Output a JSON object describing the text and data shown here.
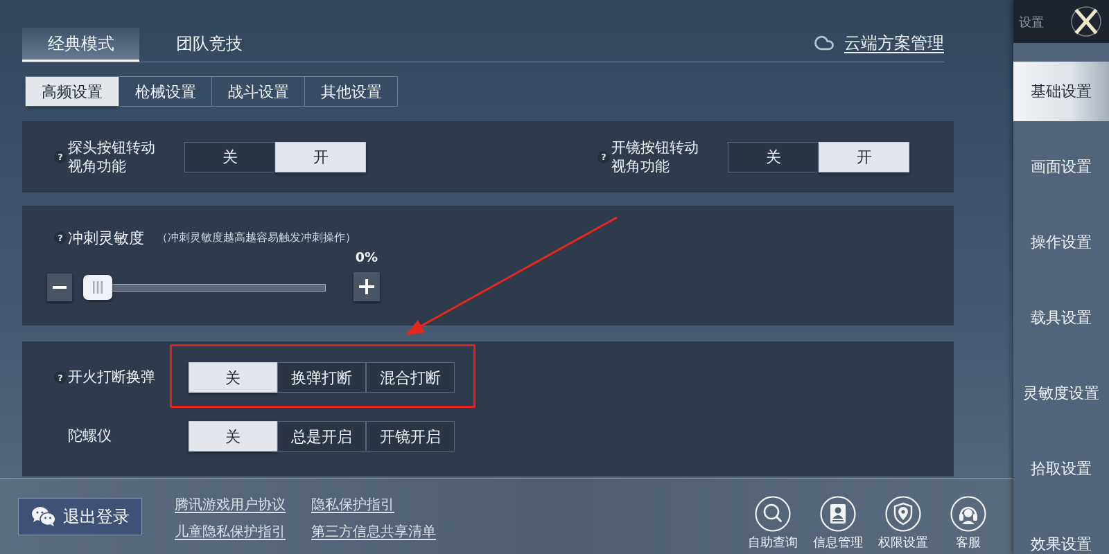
{
  "mode_tabs": [
    {
      "label": "经典模式",
      "selected": true
    },
    {
      "label": "团队竞技",
      "selected": false
    }
  ],
  "cloud_link": {
    "label": "云端方案管理"
  },
  "sub_tabs": [
    {
      "label": "高频设置",
      "selected": true
    },
    {
      "label": "枪械设置",
      "selected": false
    },
    {
      "label": "战斗设置",
      "selected": false
    },
    {
      "label": "其他设置",
      "selected": false
    }
  ],
  "view_toggles": [
    {
      "help": "?",
      "label": "探头按钮转动视角功能",
      "options": [
        {
          "label": "关",
          "selected": false
        },
        {
          "label": "开",
          "selected": true
        }
      ]
    },
    {
      "help": "?",
      "label": "开镜按钮转动视角功能",
      "options": [
        {
          "label": "关",
          "selected": false
        },
        {
          "label": "开",
          "selected": true
        }
      ]
    }
  ],
  "sprint_sensitivity": {
    "help": "?",
    "label": "冲刺灵敏度",
    "hint": "（冲刺灵敏度越高越容易触发冲刺操作）",
    "reading": "0%",
    "level": 0
  },
  "choice_rows": [
    {
      "help": "?",
      "label": "开火打断换弹",
      "highlighted": true,
      "options": [
        {
          "label": "关",
          "selected": true
        },
        {
          "label": "换弹打断",
          "selected": false
        },
        {
          "label": "混合打断",
          "selected": false
        }
      ]
    },
    {
      "label": "陀螺仪",
      "highlighted": false,
      "options": [
        {
          "label": "关",
          "selected": true
        },
        {
          "label": "总是开启",
          "selected": false
        },
        {
          "label": "开镜开启",
          "selected": false
        }
      ]
    }
  ],
  "footer": {
    "logout_button": "退出登录",
    "links": [
      "腾讯游戏用户协议",
      "隐私保护指引",
      "儿童隐私保护指引",
      "第三方信息共享清单"
    ],
    "quick_actions": [
      {
        "kind": "search",
        "label": "自助查询"
      },
      {
        "kind": "profile",
        "label": "信息管理"
      },
      {
        "kind": "shield",
        "label": "权限设置"
      },
      {
        "kind": "support",
        "label": "客服"
      }
    ]
  },
  "sidebar": {
    "title": "设置",
    "items": [
      {
        "label": "基础设置",
        "selected": true
      },
      {
        "label": "画面设置",
        "selected": false
      },
      {
        "label": "操作设置",
        "selected": false
      },
      {
        "label": "载具设置",
        "selected": false
      },
      {
        "label": "灵敏度设置",
        "selected": false
      },
      {
        "label": "拾取设置",
        "selected": false
      },
      {
        "label": "效果设置",
        "selected": false
      }
    ]
  }
}
